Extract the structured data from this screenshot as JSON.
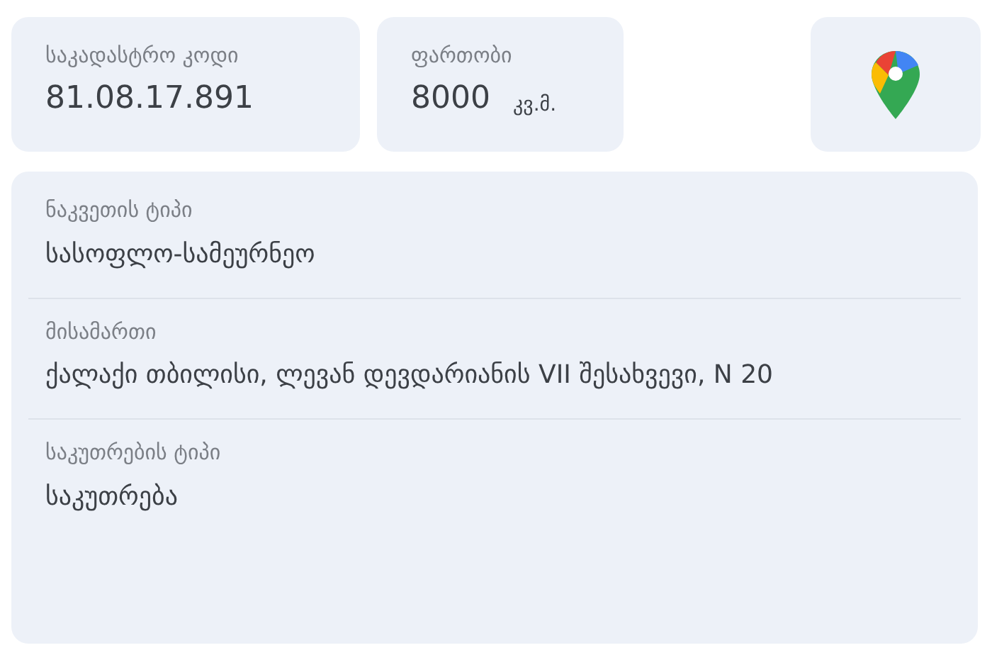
{
  "cadastral_code": {
    "label": "საკადასტრო კოდი",
    "value": "81.08.17.891"
  },
  "area": {
    "label": "ფართობი",
    "value": "8000",
    "unit": "კვ.მ."
  },
  "details": [
    {
      "label": "ნაკვეთის ტიპი",
      "value": "სასოფლო-სამეურნეო"
    },
    {
      "label": "მისამართი",
      "value": "ქალაქი თბილისი, ლევან დევდარიანის VII შესახვევი, N 20"
    },
    {
      "label": "საკუთრების ტიპი",
      "value": "საკუთრება"
    }
  ]
}
